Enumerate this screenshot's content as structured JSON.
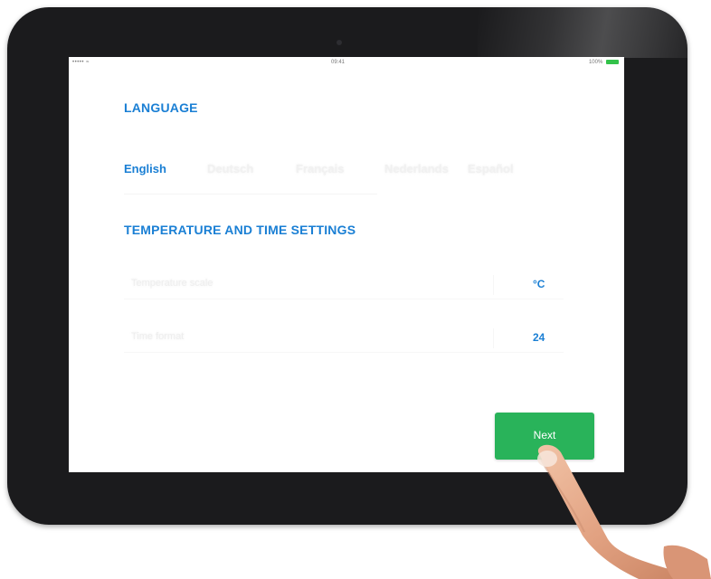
{
  "status_bar": {
    "left": "••••• ≈",
    "time": "09:41",
    "right": "100%"
  },
  "language": {
    "title": "LANGUAGE",
    "options": [
      "English",
      "Deutsch",
      "Français",
      "Nederlands",
      "Español"
    ],
    "selected": "English"
  },
  "temperature_time": {
    "title": "TEMPERATURE AND TIME SETTINGS",
    "rows": [
      {
        "label": "Temperature scale",
        "value": "°C"
      },
      {
        "label": "Time format",
        "value": "24"
      }
    ]
  },
  "actions": {
    "next_label": "Next"
  },
  "colors": {
    "accent": "#1a7fd4",
    "button": "#29b35a",
    "bezel": "#1b1b1d"
  }
}
